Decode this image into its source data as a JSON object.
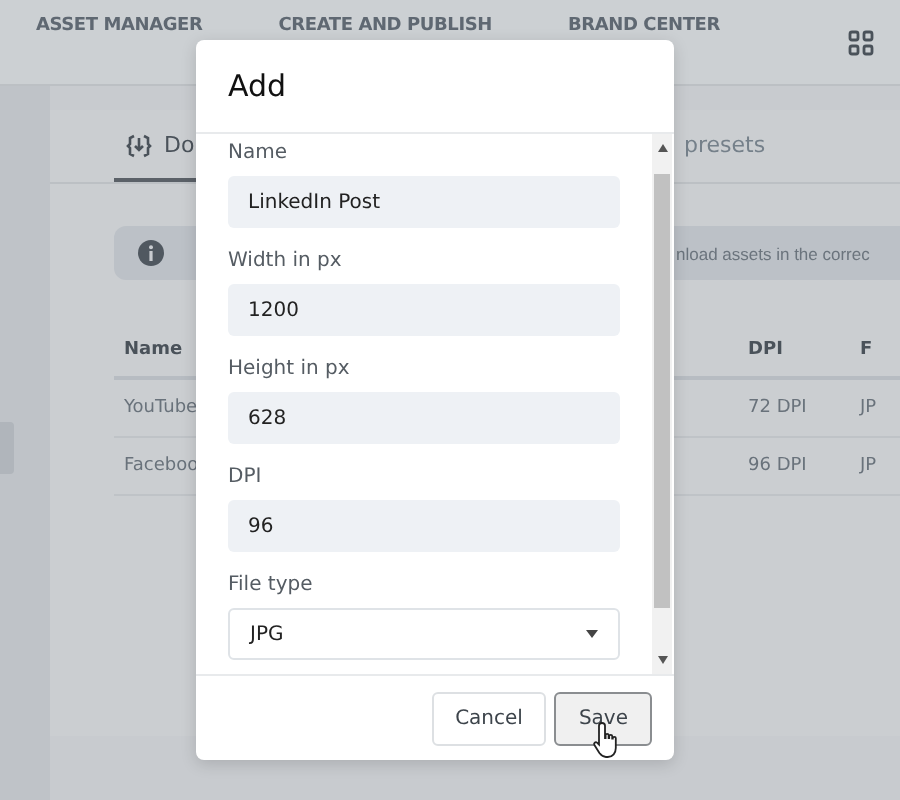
{
  "top_nav": {
    "items": [
      {
        "label": "ASSET MANAGER"
      },
      {
        "label": "CREATE AND PUBLISH"
      },
      {
        "label": "BRAND CENTER"
      }
    ]
  },
  "tabs": [
    {
      "label": "Do",
      "selected": true
    },
    {
      "label": "presets",
      "selected": false
    }
  ],
  "info_bar": {
    "text": "nload assets in the correc"
  },
  "table": {
    "columns": [
      "Name",
      "DPI",
      "F"
    ],
    "rows": [
      [
        "YouTube",
        "72 DPI",
        "JP"
      ],
      [
        "Faceboo",
        "96 DPI",
        "JP"
      ]
    ]
  },
  "dialog": {
    "title": "Add",
    "fields": [
      {
        "kind": "text",
        "label": "Name",
        "value": "LinkedIn Post"
      },
      {
        "kind": "text",
        "label": "Width in px",
        "value": "1200"
      },
      {
        "kind": "text",
        "label": "Height in px",
        "value": "628"
      },
      {
        "kind": "text",
        "label": "DPI",
        "value": "96"
      },
      {
        "kind": "select",
        "label": "File type",
        "value": "JPG"
      }
    ],
    "buttons": [
      {
        "label": "Cancel",
        "kind": "secondary"
      },
      {
        "label": "Save",
        "kind": "primary"
      }
    ]
  }
}
